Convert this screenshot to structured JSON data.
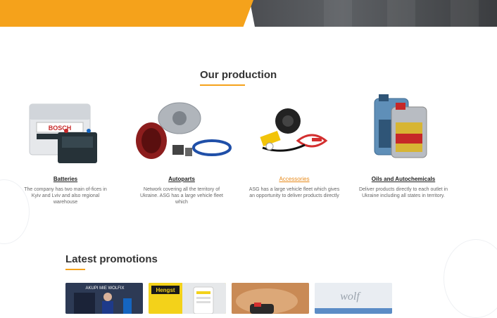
{
  "production": {
    "title": "Our production",
    "items": [
      {
        "name": "Batteries",
        "desc": "The company has two main of-fices in Kyiv and Lviv and also regional warehouse",
        "active": false
      },
      {
        "name": "Autoparts",
        "desc": "Network covering all the territory of Ukraine. ASG has a large vehicle fleet which",
        "active": false
      },
      {
        "name": "Accessories",
        "desc": "ASG has a large vehicle fleet which gives an opportunity to deliver products directly",
        "active": true
      },
      {
        "name": "Oils and Autochemicals",
        "desc": "Deliver products directly to each outlet in Ukraine including all states in territory.",
        "active": false
      }
    ]
  },
  "promotions": {
    "title": "Latest promotions",
    "cards": [
      {
        "label": "AKUPI MIE WOLFIX"
      },
      {
        "label": "Hengst"
      },
      {
        "label": ""
      },
      {
        "label": "wolf"
      }
    ]
  },
  "colors": {
    "accent": "#f5a21b",
    "dark": "#4a4c50",
    "link_active": "#e88a1a"
  }
}
